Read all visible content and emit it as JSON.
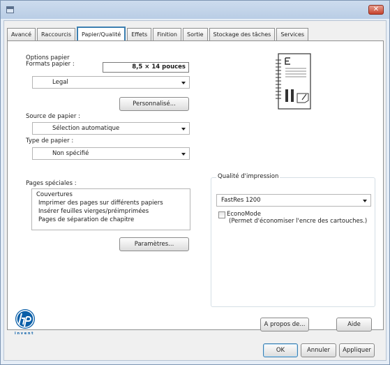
{
  "window": {
    "close_label": "✕"
  },
  "tabs": [
    {
      "label": "Avancé"
    },
    {
      "label": "Raccourcis"
    },
    {
      "label": "Papier/Qualité"
    },
    {
      "label": "Effets"
    },
    {
      "label": "Finition"
    },
    {
      "label": "Sortie"
    },
    {
      "label": "Stockage des tâches"
    },
    {
      "label": "Services"
    }
  ],
  "paper_options": {
    "section_label": "Options papier",
    "formats_label": "Formats papier :",
    "format_size": "8,5 × 14 pouces",
    "format_selected": "Legal",
    "custom_button": "Personnalisé...",
    "source_label": "Source de papier :",
    "source_selected": "Sélection automatique",
    "type_label": "Type de papier :",
    "type_selected": "Non spécifié"
  },
  "special_pages": {
    "label": "Pages spéciales :",
    "items": [
      "Couvertures",
      "Imprimer des pages sur différents papiers",
      "Insérer feuilles vierges/préimprimées",
      "Pages de séparation de chapitre"
    ],
    "settings_button": "Paramètres..."
  },
  "print_quality": {
    "label": "Qualité d'impression",
    "selected": "FastRes 1200",
    "economode_label": "EconoMode",
    "economode_desc": "(Permet d'économiser l'encre des cartouches.)",
    "economode_checked": false
  },
  "logo": {
    "brand_text": "i n v e n t"
  },
  "buttons": {
    "about": "A propos de...",
    "help": "Aide",
    "ok": "OK",
    "cancel": "Annuler",
    "apply": "Appliquer"
  }
}
